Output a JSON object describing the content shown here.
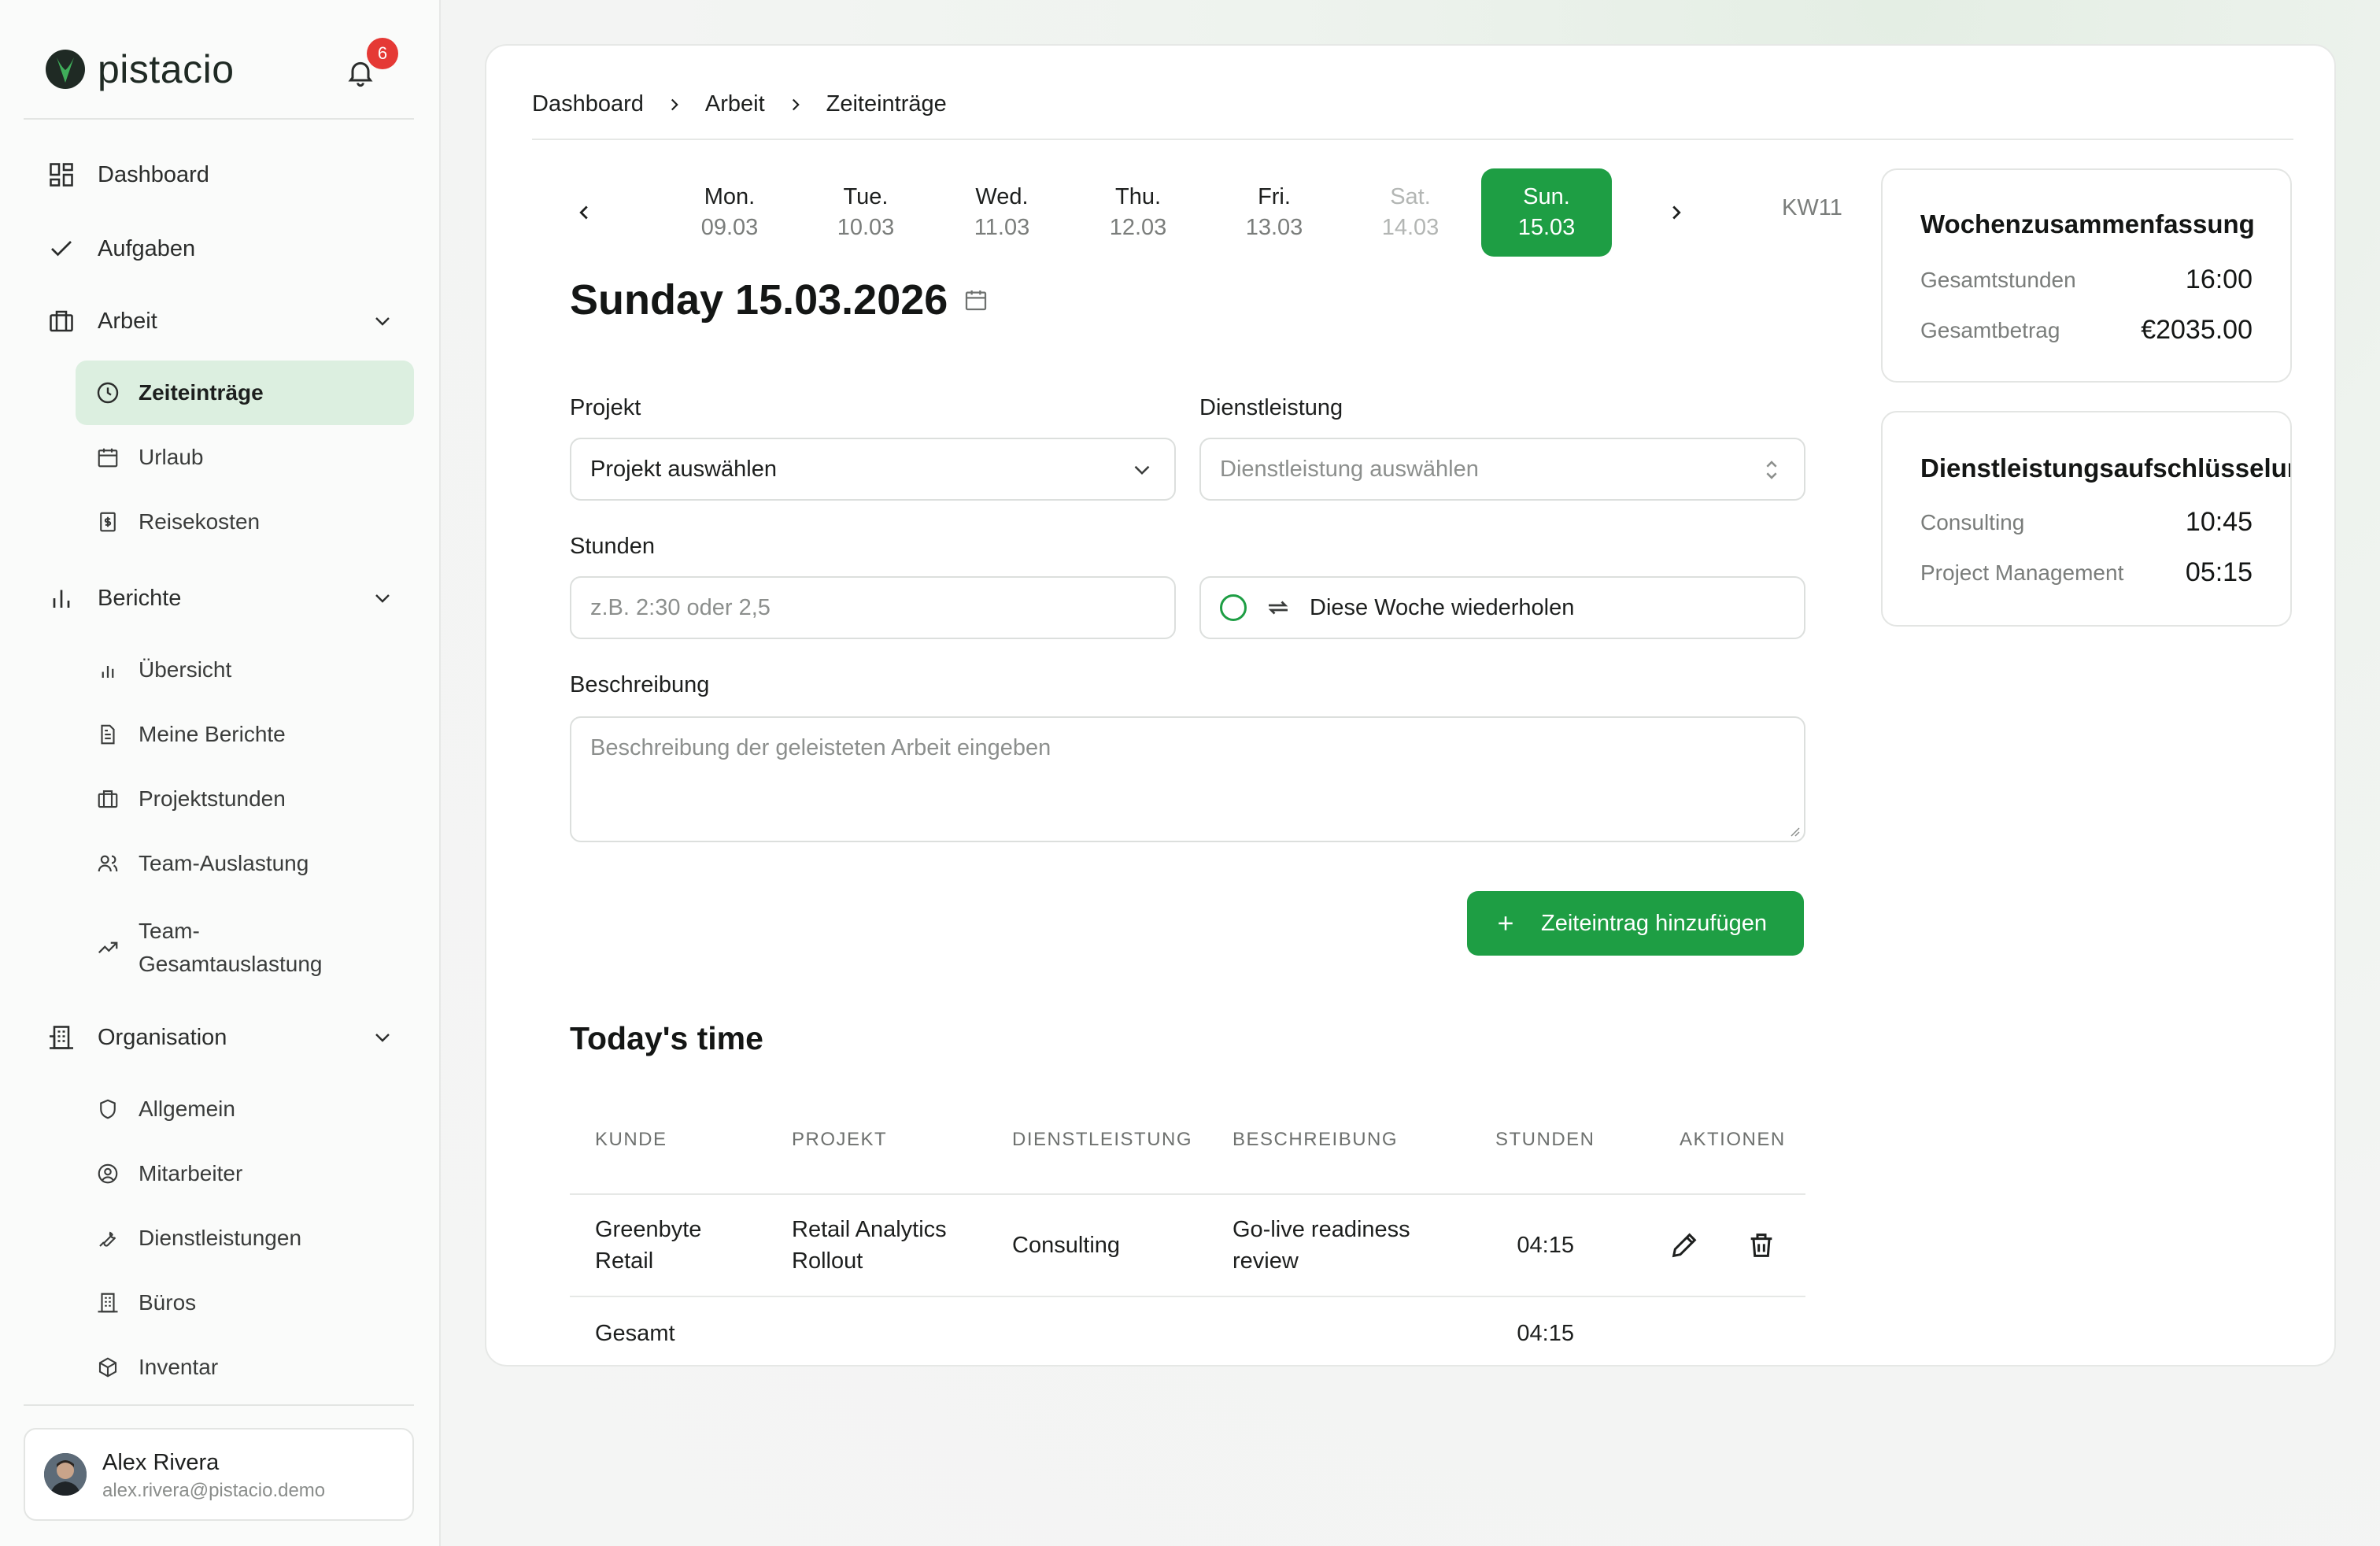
{
  "brand": {
    "name": "pistacio",
    "notifications": "6"
  },
  "sidebar": {
    "top": [
      {
        "label": "Dashboard"
      },
      {
        "label": "Aufgaben"
      },
      {
        "label": "Arbeit"
      }
    ],
    "arbeit": [
      {
        "label": "Zeiteinträge"
      },
      {
        "label": "Urlaub"
      },
      {
        "label": "Reisekosten"
      }
    ],
    "berichte": {
      "label": "Berichte"
    },
    "berichte_items": [
      {
        "label": "Übersicht"
      },
      {
        "label": "Meine Berichte"
      },
      {
        "label": "Projektstunden"
      },
      {
        "label": "Team-Auslastung"
      },
      {
        "label": "Team-"
      },
      {
        "label": "Gesamtauslastung"
      }
    ],
    "organisation": {
      "label": "Organisation"
    },
    "organisation_items": [
      {
        "label": "Allgemein"
      },
      {
        "label": "Mitarbeiter"
      },
      {
        "label": "Dienstleistungen"
      },
      {
        "label": "Büros"
      },
      {
        "label": "Inventar"
      }
    ],
    "user": {
      "name": "Alex Rivera",
      "email": "alex.rivera@pistacio.demo"
    }
  },
  "breadcrumb": [
    "Dashboard",
    "Arbeit",
    "Zeiteinträge"
  ],
  "days": [
    {
      "name": "Mon.",
      "date": "09.03"
    },
    {
      "name": "Tue.",
      "date": "10.03"
    },
    {
      "name": "Wed.",
      "date": "11.03"
    },
    {
      "name": "Thu.",
      "date": "12.03"
    },
    {
      "name": "Fri.",
      "date": "13.03"
    },
    {
      "name": "Sat.",
      "date": "14.03"
    },
    {
      "name": "Sun.",
      "date": "15.03"
    }
  ],
  "week_label": "KW11",
  "date_title": "Sunday 15.03.2026",
  "form": {
    "projekt_label": "Projekt",
    "projekt_value": "Projekt auswählen",
    "dienst_label": "Dienstleistung",
    "dienst_placeholder": "Dienstleistung auswählen",
    "stunden_label": "Stunden",
    "stunden_placeholder": "z.B. 2:30 oder 2,5",
    "repeat_label": "Diese Woche wiederholen",
    "beschreibung_label": "Beschreibung",
    "beschreibung_placeholder": "Beschreibung der geleisteten Arbeit eingeben",
    "add_label": "Zeiteintrag hinzufügen"
  },
  "today": {
    "title": "Today's time",
    "headers": [
      "KUNDE",
      "PROJEKT",
      "DIENSTLEISTUNG",
      "BESCHREIBUNG",
      "STUNDEN",
      "AKTIONEN"
    ],
    "row": {
      "kunde": [
        "Greenbyte",
        "Retail"
      ],
      "projekt": [
        "Retail Analytics",
        "Rollout"
      ],
      "dienst": "Consulting",
      "beschreibung": [
        "Go-live readiness",
        "review"
      ],
      "stunden": "04:15"
    },
    "total_label": "Gesamt",
    "total_value": "04:15"
  },
  "summary": {
    "title": "Wochenzusammenfassung",
    "hours_label": "Gesamtstunden",
    "hours_value": "16:00",
    "amount_label": "Gesamtbetrag",
    "amount_value": "€2035.00"
  },
  "breakdown": {
    "title": "Dienstleistungsaufschlüsselung",
    "items": [
      {
        "label": "Consulting",
        "value": "10:45"
      },
      {
        "label": "Project Management",
        "value": "05:15"
      }
    ]
  },
  "colors": {
    "accent": "#1e9e44",
    "active_nav": "#dcefe0",
    "badge": "#e53935"
  }
}
